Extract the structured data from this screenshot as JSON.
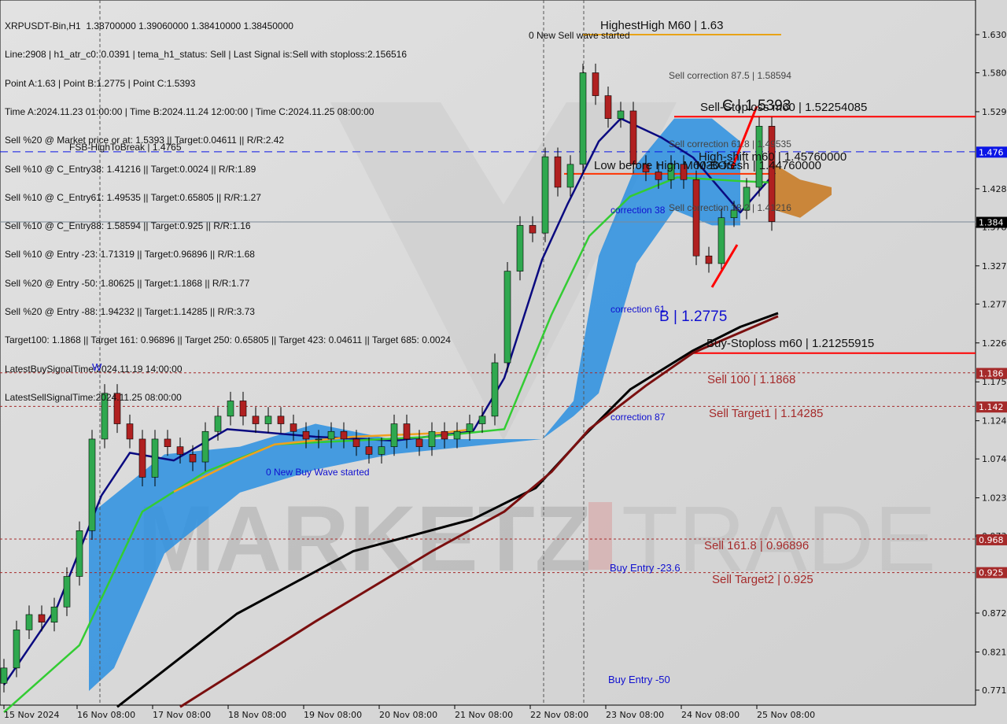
{
  "header": {
    "lines": [
      "XRPUSDT-Bin,H1  1.38700000 1.39060000 1.38410000 1.38450000",
      "Line:2908 | h1_atr_c0: 0.0391 | tema_h1_status: Sell | Last Signal is:Sell with stoploss:2.156516",
      "Point A:1.63 | Point B:1.2775 | Point C:1.5393",
      "Time A:2024.11.23 01:00:00 | Time B:2024.11.24 12:00:00 | Time C:2024.11.25 08:00:00",
      "Sell %20 @ Market price or at: 1.5393 || Target:0.04611 || R/R:2.42",
      "Sell %10 @ C_Entry38: 1.41216 || Target:0.0024 || R/R:1.89",
      "Sell %10 @ C_Entry61: 1.49535 || Target:0.65805 || R/R:1.27",
      "Sell %10 @ C_Entry88: 1.58594 || Target:0.925 || R/R:1.16",
      "Sell %10 @ Entry -23: 1.71319 || Target:0.96896 || R/R:1.68",
      "Sell %20 @ Entry -50: 1.80625 || Target:1.1868 || R/R:1.77",
      "Sell %20 @ Entry -88: 1.94232 || Target:1.14285 || R/R:3.73",
      "Target100: 1.1868 || Target 161: 0.96896 || Target 250: 0.65805 || Target 423: 0.04611 || Target 685: 0.0024",
      "LatestBuySignalTime:2024.11.19 14:00:00",
      "LatestSellSignalTime:2024.11.25 08:00:00"
    ]
  },
  "annotations": {
    "fsb": "FSB-HighToBreak | 1.4765",
    "new_sell_wave": "0 New Sell wave started",
    "new_buy_wave": "0 New Buy Wave started",
    "highest_high": "HighestHigh   M60 | 1.63",
    "sell_corr_875": "Sell correction 87.5 | 1.58594",
    "sell_corr_618": "Sell correction 61.8 | 1.49535",
    "sell_corr_382": "Sell correction 38.2 | 1.41216",
    "sell_stoploss": "Sell-Stoploss m60 | 1.52254085",
    "point_c": "C | 1.5393",
    "high_shift": "High-shift m60 | 1.45760000",
    "low_before_high": "Low before High   M60-BOS",
    "m30_fresh": "M30-fresh | 1.44760000",
    "point_b": "B | 1.2775",
    "buy_stoploss": "Buy-Stoploss m60 | 1.21255915",
    "sell_100": "Sell 100 | 1.1868",
    "sell_target1": "Sell Target1 | 1.14285",
    "sell_1618": "Sell 161.8 | 0.96896",
    "sell_target2": "Sell Target2 | 0.925",
    "correction_38": "correction 38",
    "correction_61": "correction 61",
    "correction_87": "correction 87",
    "buy_entry_236": "Buy Entry -23.6",
    "buy_entry_50": "Buy Entry -50",
    "wave_w": "W",
    "watermark": "MARKETZ TRADE"
  },
  "chart_data": {
    "type": "candlestick",
    "symbol": "XRPUSDT-Bin",
    "timeframe": "H1",
    "ylim": [
      0.745,
      1.675
    ],
    "y_ticks": [
      1.63,
      1.58,
      1.529,
      1.428,
      1.378,
      1.327,
      1.277,
      1.226,
      1.175,
      1.124,
      1.074,
      1.023,
      0.973,
      0.872,
      0.821,
      0.771
    ],
    "x_ticks": [
      "15 Nov 2024",
      "16 Nov 08:00",
      "17 Nov 08:00",
      "18 Nov 08:00",
      "19 Nov 08:00",
      "20 Nov 08:00",
      "21 Nov 08:00",
      "22 Nov 08:00",
      "23 Nov 08:00",
      "24 Nov 08:00",
      "25 Nov 08:00"
    ],
    "price_tags": [
      {
        "value": "1.476",
        "color": "#0a14e6"
      },
      {
        "value": "1.384",
        "color": "#000000"
      },
      {
        "value": "1.186",
        "color": "#a52a2a"
      },
      {
        "value": "1.142",
        "color": "#a52a2a"
      },
      {
        "value": "0.968",
        "color": "#a52a2a"
      },
      {
        "value": "0.925",
        "color": "#a52a2a"
      }
    ],
    "closes": [
      [
        "11-15 09:00",
        0.8
      ],
      [
        "11-15 13:00",
        0.85
      ],
      [
        "11-15 17:00",
        0.87
      ],
      [
        "11-15 21:00",
        0.86
      ],
      [
        "11-16 01:00",
        0.88
      ],
      [
        "11-16 05:00",
        0.92
      ],
      [
        "11-16 09:00",
        0.98
      ],
      [
        "11-16 13:00",
        1.1
      ],
      [
        "11-16 17:00",
        1.16
      ],
      [
        "11-16 21:00",
        1.12
      ],
      [
        "11-17 01:00",
        1.1
      ],
      [
        "11-17 05:00",
        1.05
      ],
      [
        "11-17 09:00",
        1.1
      ],
      [
        "11-17 13:00",
        1.09
      ],
      [
        "11-17 17:00",
        1.08
      ],
      [
        "11-17 21:00",
        1.07
      ],
      [
        "11-18 01:00",
        1.11
      ],
      [
        "11-18 05:00",
        1.13
      ],
      [
        "11-18 09:00",
        1.15
      ],
      [
        "11-18 13:00",
        1.13
      ],
      [
        "11-18 17:00",
        1.12
      ],
      [
        "11-18 21:00",
        1.13
      ],
      [
        "11-19 01:00",
        1.12
      ],
      [
        "11-19 05:00",
        1.11
      ],
      [
        "11-19 09:00",
        1.1
      ],
      [
        "11-19 13:00",
        1.1
      ],
      [
        "11-19 17:00",
        1.11
      ],
      [
        "11-19 21:00",
        1.1
      ],
      [
        "11-20 01:00",
        1.09
      ],
      [
        "11-20 05:00",
        1.08
      ],
      [
        "11-20 09:00",
        1.09
      ],
      [
        "11-20 13:00",
        1.12
      ],
      [
        "11-20 17:00",
        1.1
      ],
      [
        "11-20 21:00",
        1.09
      ],
      [
        "11-21 01:00",
        1.11
      ],
      [
        "11-21 05:00",
        1.1
      ],
      [
        "11-21 09:00",
        1.11
      ],
      [
        "11-21 13:00",
        1.12
      ],
      [
        "11-21 17:00",
        1.13
      ],
      [
        "11-21 21:00",
        1.2
      ],
      [
        "11-22 01:00",
        1.32
      ],
      [
        "11-22 05:00",
        1.38
      ],
      [
        "11-22 09:00",
        1.37
      ],
      [
        "11-22 13:00",
        1.47
      ],
      [
        "11-22 17:00",
        1.43
      ],
      [
        "11-22 21:00",
        1.46
      ],
      [
        "11-23 01:00",
        1.58
      ],
      [
        "11-23 05:00",
        1.55
      ],
      [
        "11-23 09:00",
        1.52
      ],
      [
        "11-23 13:00",
        1.53
      ],
      [
        "11-23 17:00",
        1.46
      ],
      [
        "11-23 21:00",
        1.45
      ],
      [
        "11-24 01:00",
        1.44
      ],
      [
        "11-24 05:00",
        1.46
      ],
      [
        "11-24 09:00",
        1.44
      ],
      [
        "11-24 13:00",
        1.34
      ],
      [
        "11-24 17:00",
        1.33
      ],
      [
        "11-24 21:00",
        1.39
      ],
      [
        "11-25 01:00",
        1.4
      ],
      [
        "11-25 05:00",
        1.43
      ],
      [
        "11-25 09:00",
        1.51
      ],
      [
        "11-25 13:00",
        1.385
      ]
    ],
    "lines": [
      {
        "color": "#0a0a80",
        "points": [
          [
            "11-15 09:00",
            0.778
          ],
          [
            "11-16 02:00",
            0.881
          ],
          [
            "11-16 16:00",
            1.026
          ],
          [
            "11-17 01:00",
            1.082
          ],
          [
            "11-17 15:00",
            1.072
          ],
          [
            "11-18 08:00",
            1.113
          ],
          [
            "11-19 12:00",
            1.103
          ],
          [
            "11-20 13:00",
            1.098
          ],
          [
            "11-21 14:00",
            1.11
          ],
          [
            "11-22 00:00",
            1.18
          ],
          [
            "11-22 12:00",
            1.335
          ],
          [
            "11-22 20:00",
            1.407
          ],
          [
            "11-23 06:00",
            1.49
          ],
          [
            "11-23 13:00",
            1.52
          ],
          [
            "11-24 02:00",
            1.495
          ],
          [
            "11-24 12:00",
            1.469
          ],
          [
            "11-25 03:00",
            1.397
          ],
          [
            "11-25 14:00",
            1.449
          ]
        ]
      },
      {
        "color": "#33cc33",
        "points": [
          [
            "11-15 09:00",
            0.742
          ],
          [
            "11-16 09:00",
            0.83
          ],
          [
            "11-17 05:00",
            1.005
          ],
          [
            "11-18 01:00",
            1.057
          ],
          [
            "11-18 23:00",
            1.093
          ],
          [
            "11-20 00:00",
            1.098
          ],
          [
            "11-21 01:00",
            1.103
          ],
          [
            "11-22 00:00",
            1.113
          ],
          [
            "11-22 15:00",
            1.263
          ],
          [
            "11-23 03:00",
            1.366
          ],
          [
            "11-23 16:00",
            1.418
          ],
          [
            "11-24 07:00",
            1.443
          ],
          [
            "11-25 03:00",
            1.438
          ],
          [
            "11-25 14:00",
            1.436
          ]
        ]
      },
      {
        "color": "#f0a020",
        "points": [
          [
            "11-17 15:00",
            1.031
          ],
          [
            "11-18 11:00",
            1.072
          ],
          [
            "11-18 23:00",
            1.093
          ],
          [
            "11-20 00:00",
            1.103
          ],
          [
            "11-21 04:00",
            1.108
          ],
          [
            "11-21 14:00",
            1.113
          ]
        ]
      },
      {
        "color": "#000000",
        "points": [
          [
            "11-16 21:00",
            0.749
          ],
          [
            "11-18 11:00",
            0.871
          ],
          [
            "11-20 00:00",
            0.953
          ],
          [
            "11-21 14:00",
            0.995
          ],
          [
            "11-22 10:00",
            1.036
          ],
          [
            "11-23 01:00",
            1.103
          ],
          [
            "11-23 16:00",
            1.165
          ],
          [
            "11-24 12:00",
            1.216
          ],
          [
            "11-25 03:00",
            1.247
          ],
          [
            "11-25 15:00",
            1.265
          ]
        ]
      },
      {
        "color": "#7a0f0f",
        "points": [
          [
            "11-17 17:00",
            0.749
          ],
          [
            "11-19 12:00",
            0.861
          ],
          [
            "11-21 01:00",
            0.953
          ],
          [
            "11-22 00:00",
            1.005
          ],
          [
            "11-22 15:00",
            1.057
          ],
          [
            "11-23 03:00",
            1.113
          ],
          [
            "11-23 21:00",
            1.17
          ],
          [
            "11-24 12:00",
            1.213
          ],
          [
            "11-25 15:00",
            1.261
          ]
        ]
      }
    ],
    "cloud_blue": {
      "color": "#2a8fe0",
      "upper": [
        [
          "11-16 12:00",
          1.0
        ],
        [
          "11-17 12:00",
          1.08
        ],
        [
          "11-18 12:00",
          1.09
        ],
        [
          "11-19 12:00",
          1.12
        ],
        [
          "11-20 12:00",
          1.1
        ],
        [
          "11-21 12:00",
          1.1
        ],
        [
          "11-22 12:00",
          1.1
        ],
        [
          "11-22 22:00",
          1.15
        ],
        [
          "11-23 06:00",
          1.34
        ],
        [
          "11-23 18:00",
          1.46
        ],
        [
          "11-24 06:00",
          1.52
        ],
        [
          "11-24 18:00",
          1.52
        ],
        [
          "11-25 03:00",
          1.49
        ]
      ],
      "lower": [
        [
          "11-25 03:00",
          1.38
        ],
        [
          "11-24 18:00",
          1.38
        ],
        [
          "11-24 06:00",
          1.4
        ],
        [
          "11-23 18:00",
          1.33
        ],
        [
          "11-23 06:00",
          1.16
        ],
        [
          "11-22 22:00",
          1.13
        ],
        [
          "11-22 12:00",
          1.1
        ],
        [
          "11-21 12:00",
          1.09
        ],
        [
          "11-20 12:00",
          1.08
        ],
        [
          "11-19 12:00",
          1.06
        ],
        [
          "11-18 12:00",
          1.03
        ],
        [
          "11-17 12:00",
          0.95
        ],
        [
          "11-16 20:00",
          0.8
        ],
        [
          "11-16 12:00",
          0.77
        ]
      ]
    },
    "cloud_orange": {
      "color": "#c8781e",
      "upper": [
        [
          "11-25 14:00",
          1.46
        ],
        [
          "11-25 22:00",
          1.44
        ],
        [
          "11-26 08:00",
          1.43
        ]
      ],
      "lower": [
        [
          "11-26 08:00",
          1.42
        ],
        [
          "11-25 22:00",
          1.39
        ],
        [
          "11-25 14:00",
          1.4
        ]
      ]
    },
    "levels": [
      {
        "name": "highest-high",
        "price": 1.63,
        "color": "#e8a317",
        "style": "solid",
        "from": "11-23 01:00",
        "to": "11-25 16:00"
      },
      {
        "name": "sell-stoploss",
        "price": 1.5225,
        "color": "#ff0000",
        "style": "solid",
        "from": "11-24 06:00",
        "to": "end"
      },
      {
        "name": "fsb-high-to-break",
        "price": 1.4765,
        "color": "#0a14e6",
        "style": "dashed",
        "from": "start",
        "to": "end"
      },
      {
        "name": "low-before-high",
        "price": 1.4476,
        "color": "#ff3300",
        "style": "solid",
        "from": "11-22 19:00",
        "to": "11-25 14:00"
      },
      {
        "name": "current-price",
        "price": 1.3845,
        "color": "#7a8896",
        "style": "thin",
        "from": "start",
        "to": "end"
      },
      {
        "name": "buy-stoploss",
        "price": 1.2126,
        "color": "#ff0000",
        "style": "solid",
        "from": "11-24 12:00",
        "to": "end"
      },
      {
        "name": "sell-100",
        "price": 1.1868,
        "color": "#a52a2a",
        "style": "dotted",
        "from": "start",
        "to": "end"
      },
      {
        "name": "sell-target1",
        "price": 1.14285,
        "color": "#a52a2a",
        "style": "dotted",
        "from": "start",
        "to": "end"
      },
      {
        "name": "sell-161-8",
        "price": 0.96896,
        "color": "#a52a2a",
        "style": "dotted",
        "from": "start",
        "to": "end"
      },
      {
        "name": "sell-target2",
        "price": 0.925,
        "color": "#a52a2a",
        "style": "dotted",
        "from": "start",
        "to": "end"
      }
    ]
  }
}
